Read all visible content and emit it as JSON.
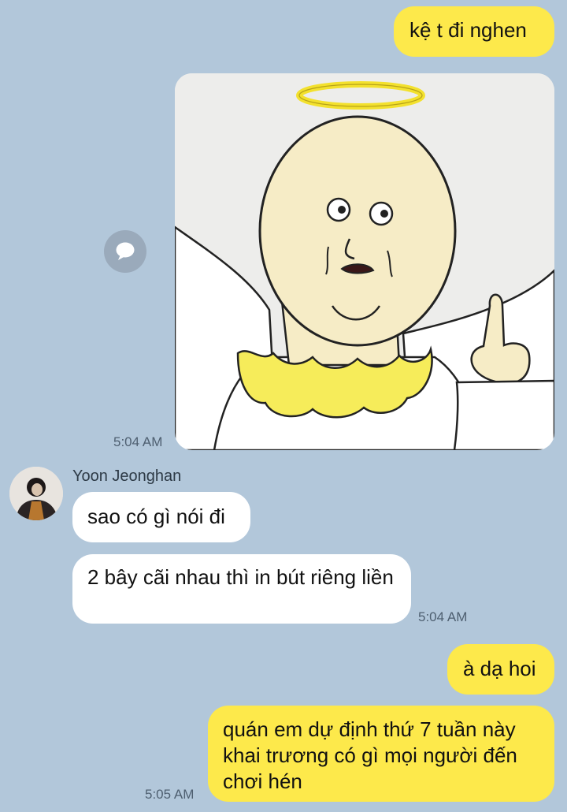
{
  "messages": {
    "m1": {
      "text": "kệ t đi nghen"
    },
    "image_time": "5:04 AM",
    "sender": {
      "name": "Yoon Jeonghan"
    },
    "m2": {
      "text": "sao có gì nói đi"
    },
    "m3": {
      "text": "2 bây cãi nhau thì in bút riêng liền",
      "time": "5:04 AM"
    },
    "m4": {
      "text": "à dạ hoi"
    },
    "m5": {
      "text": "quán em dự định thứ 7 tuần này khai trương có gì mọi người đến chơi hén",
      "time": "5:05 AM"
    }
  },
  "icons": {
    "share": "speech-bubble-icon",
    "avatar": "profile-photo"
  },
  "colors": {
    "background": "#b2c7da",
    "outgoing_bubble": "#fde94b",
    "incoming_bubble": "#ffffff",
    "timestamp": "#4e5f70"
  }
}
